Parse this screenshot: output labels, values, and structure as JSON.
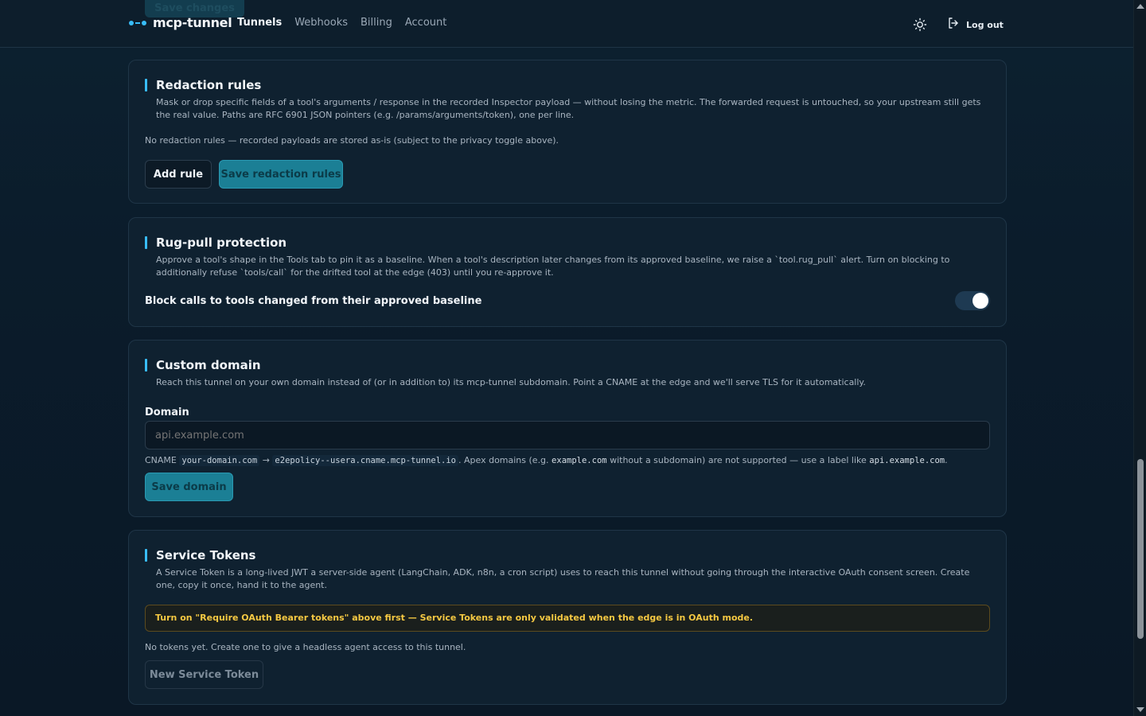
{
  "nav": {
    "ghost_button_label": "Save changes",
    "brand": "mcp-tunnel",
    "links": [
      "Tunnels",
      "Webhooks",
      "Billing",
      "Account"
    ],
    "active_link": "Tunnels",
    "logout_label": "Log out",
    "theme_icon": "sun-icon",
    "logout_icon": "logout-icon"
  },
  "redaction": {
    "title": "Redaction rules",
    "description": "Mask or drop specific fields of a tool's arguments / response in the recorded Inspector payload — without losing the metric. The forwarded request is untouched, so your upstream still gets the real value. Paths are RFC 6901 JSON pointers (e.g. /params/arguments/token), one per line.",
    "empty_note": "No redaction rules — recorded payloads are stored as-is (subject to the privacy toggle above).",
    "add_button": "Add rule",
    "save_button": "Save redaction rules"
  },
  "rugpull": {
    "title": "Rug-pull protection",
    "description": "Approve a tool's shape in the Tools tab to pin it as a baseline. When a tool's description later changes from its approved baseline, we raise a `tool.rug_pull` alert. Turn on blocking to additionally refuse `tools/call` for the drifted tool at the edge (403) until you re-approve it.",
    "toggle_label": "Block calls to tools changed from their approved baseline",
    "toggle_on": true
  },
  "custom_domain": {
    "title": "Custom domain",
    "description": "Reach this tunnel on your own domain instead of (or in addition to) its mcp-tunnel subdomain. Point a CNAME at the edge and we'll serve TLS for it automatically.",
    "field_label": "Domain",
    "placeholder": "api.example.com",
    "value": "",
    "cname_prefix": "CNAME",
    "cname_source": "your-domain.com",
    "cname_arrow": "→",
    "cname_target": "e2epolicy--usera.cname.mcp-tunnel.io",
    "apex_note_1": ". Apex domains (e.g.",
    "apex_example": "example.com",
    "apex_note_2": "without a subdomain) are not supported — use a label like",
    "label_example": "api.example.com",
    "apex_note_3": ".",
    "save_button": "Save domain"
  },
  "service_tokens": {
    "title": "Service Tokens",
    "description": "A Service Token is a long-lived JWT a server-side agent (LangChain, ADK, n8n, a cron script) uses to reach this tunnel without going through the interactive OAuth consent screen. Create one, copy it once, hand it to the agent.",
    "warning": "Turn on \"Require OAuth Bearer tokens\" above first — Service Tokens are only validated when the edge is in OAuth mode.",
    "empty_note": "No tokens yet. Create one to give a headless agent access to this tunnel.",
    "new_button": "New Service Token"
  },
  "colors": {
    "accent": "#38bdf8",
    "primary_button": "#1b7f95",
    "warning_text": "#f5c842",
    "background": "#0b1c2b"
  }
}
